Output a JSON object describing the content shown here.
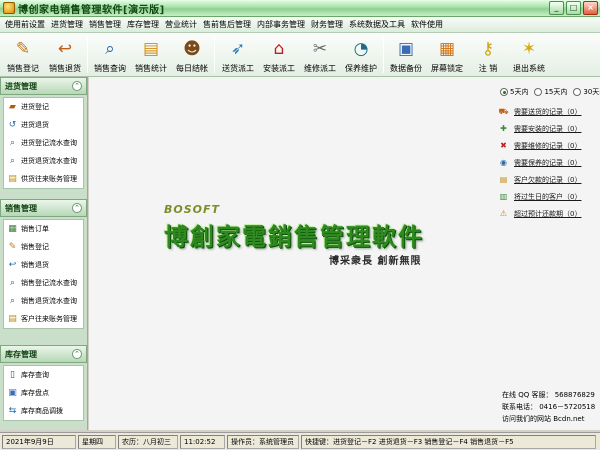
{
  "window": {
    "title": "博创家电销售管理软件[演示版]"
  },
  "menu": [
    "使用前设置",
    "进货管理",
    "销售管理",
    "库存管理",
    "营业统计",
    "售前售后管理",
    "内部事务管理",
    "财务管理",
    "系统数据及工具",
    "软件使用"
  ],
  "toolbar": [
    {
      "label": "销售登记",
      "icon": "pencil-icon",
      "glyph": "✎",
      "color": "#c07a1a"
    },
    {
      "label": "销售退货",
      "icon": "return-icon",
      "glyph": "↩",
      "color": "#c0601a"
    },
    {
      "label": "销售查询",
      "icon": "magnifier-icon",
      "glyph": "⌕",
      "color": "#2c5fa8"
    },
    {
      "label": "销售统计",
      "icon": "chart-icon",
      "glyph": "▤",
      "color": "#d48a10"
    },
    {
      "label": "每日结帐",
      "icon": "person-icon",
      "glyph": "☻",
      "color": "#7a4a1a"
    },
    {
      "label": "送货派工",
      "icon": "send-icon",
      "glyph": "➶",
      "color": "#2a7ab8"
    },
    {
      "label": "安装派工",
      "icon": "house-icon",
      "glyph": "⌂",
      "color": "#c01e1e"
    },
    {
      "label": "维修派工",
      "icon": "wrench-icon",
      "glyph": "✂",
      "color": "#6a6a6a"
    },
    {
      "label": "保养维护",
      "icon": "gauge-icon",
      "glyph": "◔",
      "color": "#1e6a8a"
    },
    {
      "label": "数据备份",
      "icon": "database-icon",
      "glyph": "▣",
      "color": "#3a6ab8"
    },
    {
      "label": "屏幕锁定",
      "icon": "lock-screen-icon",
      "glyph": "▦",
      "color": "#d07010"
    },
    {
      "label": "注 销",
      "icon": "key-icon",
      "glyph": "⚷",
      "color": "#d4a010"
    },
    {
      "label": "退出系统",
      "icon": "exit-icon",
      "glyph": "✶",
      "color": "#d8a818"
    }
  ],
  "sidebar": {
    "groups": [
      {
        "title": "进货管理",
        "items": [
          {
            "label": "进货登记",
            "icon": "notebook-icon",
            "glyph": "▰",
            "color": "#b05a10"
          },
          {
            "label": "进货退货",
            "icon": "return-icon",
            "glyph": "↺",
            "color": "#2a6aa8"
          },
          {
            "label": "进货登记流水查询",
            "icon": "magnifier-icon",
            "glyph": "⌕",
            "color": "#2a5a9a"
          },
          {
            "label": "进货退货流水查询",
            "icon": "magnifier-icon",
            "glyph": "⌕",
            "color": "#2a5a9a"
          },
          {
            "label": "供货往来账务管理",
            "icon": "ledger-icon",
            "glyph": "▤",
            "color": "#c08a10"
          }
        ]
      },
      {
        "title": "销售管理",
        "items": [
          {
            "label": "销售订单",
            "icon": "order-icon",
            "glyph": "▦",
            "color": "#3a7a3a"
          },
          {
            "label": "销售登记",
            "icon": "pencil-icon",
            "glyph": "✎",
            "color": "#c07a1a"
          },
          {
            "label": "销售退货",
            "icon": "return-icon",
            "glyph": "↩",
            "color": "#2a6aa8"
          },
          {
            "label": "销售登记流水查询",
            "icon": "magnifier-icon",
            "glyph": "⌕",
            "color": "#2a5a9a"
          },
          {
            "label": "销售退货流水查询",
            "icon": "magnifier-icon",
            "glyph": "⌕",
            "color": "#2a5a9a"
          },
          {
            "label": "客户往来账务管理",
            "icon": "ledger-icon",
            "glyph": "▤",
            "color": "#c08a10"
          }
        ]
      },
      {
        "title": "库存管理",
        "items": [
          {
            "label": "库存查询",
            "icon": "document-icon",
            "glyph": "▯",
            "color": "#4a4a4a"
          },
          {
            "label": "库存盘点",
            "icon": "inventory-icon",
            "glyph": "▣",
            "color": "#3a6ab8"
          },
          {
            "label": "库存商品调拨",
            "icon": "transfer-icon",
            "glyph": "⇆",
            "color": "#2a6aa8"
          }
        ]
      }
    ]
  },
  "main": {
    "brand_small": "BOSOFT",
    "brand_big": "博創家電銷售管理軟件",
    "slogan": "博采衆長  創新無限",
    "ranges": [
      {
        "label": "5天内",
        "selected": true
      },
      {
        "label": "15天内",
        "selected": false
      },
      {
        "label": "30天内",
        "selected": false
      }
    ],
    "reminders": [
      {
        "label": "需要送货的记录（0）",
        "icon": "truck-icon",
        "glyph": "⛟",
        "color": "#c06010"
      },
      {
        "label": "需要安装的记录（0）",
        "icon": "install-icon",
        "glyph": "✚",
        "color": "#3a8a3a"
      },
      {
        "label": "需要维修的记录（0）",
        "icon": "repair-icon",
        "glyph": "✖",
        "color": "#c02020"
      },
      {
        "label": "需要保养的记录（0）",
        "icon": "maintenance-icon",
        "glyph": "◉",
        "color": "#2a6aa8"
      },
      {
        "label": "客户欠款的记录（0）",
        "icon": "debt-icon",
        "glyph": "▤",
        "color": "#c08a10"
      },
      {
        "label": "将过生日的客户（0）",
        "icon": "birthday-icon",
        "glyph": "▥",
        "color": "#3a8a3a"
      },
      {
        "label": "超过预计还款期（0）",
        "icon": "warning-icon",
        "glyph": "⚠",
        "color": "#d08a00"
      }
    ],
    "contact": {
      "qq": "在线 QQ 客服： 568876829",
      "phone": "联系电话： 0416－5720518",
      "site": "访问我们的网站  Bcdn.net"
    }
  },
  "status": {
    "date": "2021年9月9日",
    "weekday": "星期四",
    "lunar": "农历：八月初三",
    "time": "11:02:52",
    "operator": "操作员：系统管理员",
    "hotkeys": "快捷键：进货登记－F2 进货退货－F3 销售登记－F4 销售退货－F5"
  }
}
